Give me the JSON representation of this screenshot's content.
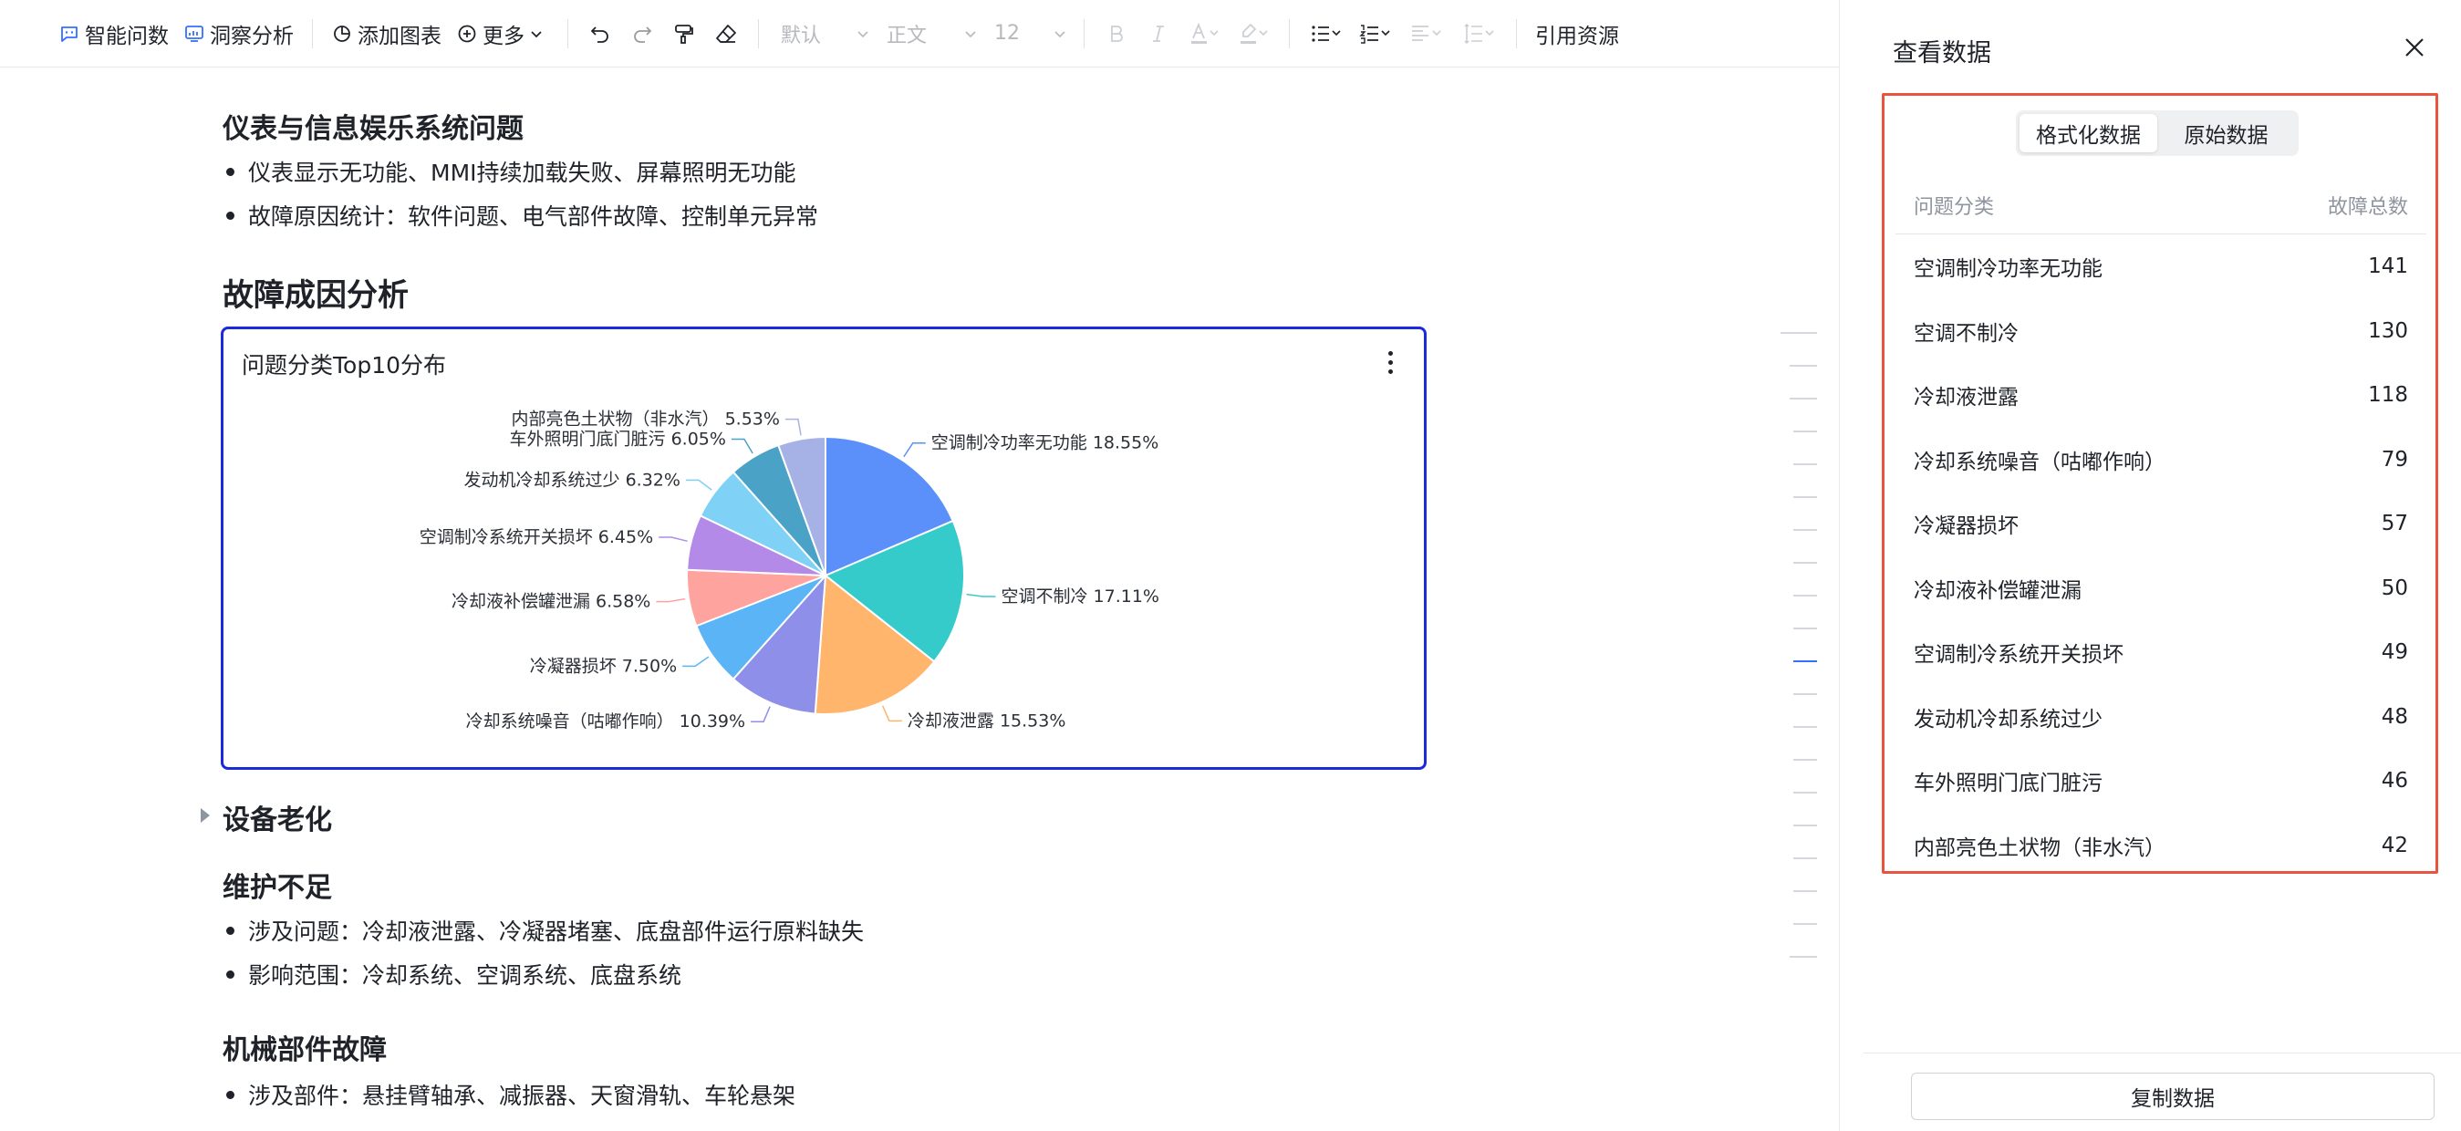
{
  "toolbar": {
    "smart_query": "智能问数",
    "insight": "洞察分析",
    "add_chart": "添加图表",
    "more": "更多",
    "font_select": "默认",
    "style_select": "正文",
    "size_select": "12",
    "cite": "引用资源"
  },
  "doc": {
    "section1_title": "仪表与信息娱乐系统问题",
    "section1_bullets": [
      "仪表显示无功能、MMI持续加载失败、屏幕照明无功能",
      "故障原因统计：软件问题、电气部件故障、控制单元异常"
    ],
    "section2_title": "故障成因分析",
    "section3_title": "设备老化",
    "section4_title": "维护不足",
    "section4_bullets": [
      "涉及问题：冷却液泄露、冷凝器堵塞、底盘部件运行原料缺失",
      "影响范围：冷却系统、空调系统、底盘系统"
    ],
    "section5_title": "机械部件故障",
    "section5_bullets": [
      "涉及部件：悬挂臂轴承、减振器、天窗滑轨、车轮悬架"
    ]
  },
  "chart_data": {
    "type": "pie",
    "title": "问题分类Top10分布",
    "slices": [
      {
        "label": "空调制冷功率无功能",
        "value": 141,
        "percent": "18.55%",
        "color": "#5b8ff9"
      },
      {
        "label": "空调不制冷",
        "value": 130,
        "percent": "17.11%",
        "color": "#36cbcb"
      },
      {
        "label": "冷却液泄露",
        "value": 118,
        "percent": "15.53%",
        "color": "#ffb56b"
      },
      {
        "label": "冷却系统噪音（咕嘟作响）",
        "value": 79,
        "percent": "10.39%",
        "color": "#8e8fe8"
      },
      {
        "label": "冷凝器损坏",
        "value": 57,
        "percent": "7.50%",
        "color": "#5ab4f5"
      },
      {
        "label": "冷却液补偿罐泄漏",
        "value": 50,
        "percent": "6.58%",
        "color": "#ffa39e"
      },
      {
        "label": "空调制冷系统开关损坏",
        "value": 49,
        "percent": "6.45%",
        "color": "#b48ae8"
      },
      {
        "label": "发动机冷却系统过少",
        "value": 48,
        "percent": "6.32%",
        "color": "#7fd1f5"
      },
      {
        "label": "车外照明门底门脏污",
        "value": 46,
        "percent": "6.05%",
        "color": "#4aa3c6"
      },
      {
        "label": "内部亮色土状物（非水汽）",
        "value": 42,
        "percent": "5.53%",
        "color": "#a6b1e6"
      }
    ]
  },
  "panel": {
    "title": "查看数据",
    "tab_formatted": "格式化数据",
    "tab_raw": "原始数据",
    "col_category": "问题分类",
    "col_total": "故障总数",
    "rows": [
      {
        "category": "空调制冷功率无功能",
        "total": "141"
      },
      {
        "category": "空调不制冷",
        "total": "130"
      },
      {
        "category": "冷却液泄露",
        "total": "118"
      },
      {
        "category": "冷却系统噪音（咕嘟作响）",
        "total": "79"
      },
      {
        "category": "冷凝器损坏",
        "total": "57"
      },
      {
        "category": "冷却液补偿罐泄漏",
        "total": "50"
      },
      {
        "category": "空调制冷系统开关损坏",
        "total": "49"
      },
      {
        "category": "发动机冷却系统过少",
        "total": "48"
      },
      {
        "category": "车外照明门底门脏污",
        "total": "46"
      },
      {
        "category": "内部亮色土状物（非水汽）",
        "total": "42"
      }
    ],
    "copy_button": "复制数据"
  }
}
